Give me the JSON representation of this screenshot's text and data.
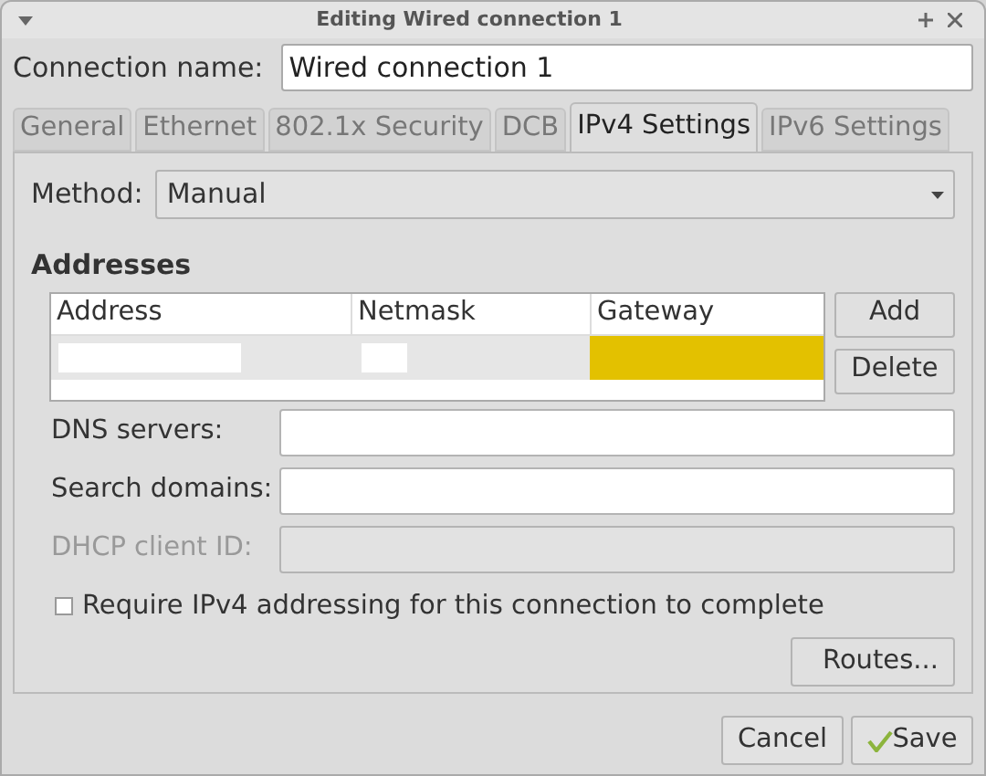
{
  "window": {
    "title": "Editing Wired connection 1"
  },
  "connection_name": {
    "label": "Connection name:",
    "value": "Wired connection 1"
  },
  "tabs": [
    {
      "label": "General",
      "selected": false
    },
    {
      "label": "Ethernet",
      "selected": false
    },
    {
      "label": "802.1x Security",
      "selected": false
    },
    {
      "label": "DCB",
      "selected": false
    },
    {
      "label": "IPv4 Settings",
      "selected": true
    },
    {
      "label": "IPv6 Settings",
      "selected": false
    }
  ],
  "method": {
    "label": "Method:",
    "value": "Manual"
  },
  "addresses": {
    "title": "Addresses",
    "columns": [
      "Address",
      "Netmask",
      "Gateway"
    ],
    "rows": [
      {
        "cells": [
          {
            "redacted": true,
            "editing": false
          },
          {
            "redacted": true,
            "editing": false
          },
          {
            "redacted": false,
            "editing": true
          }
        ]
      }
    ],
    "buttons": [
      "Add",
      "Delete"
    ]
  },
  "fields": [
    {
      "label": "DNS servers:",
      "disabled": false
    },
    {
      "label": "Search domains:",
      "disabled": false
    },
    {
      "label": "DHCP client ID:",
      "disabled": true
    }
  ],
  "require_checkbox": {
    "label": "Require IPv4 addressing for this connection to complete",
    "checked": false
  },
  "routes_button": "Routes...",
  "footer_buttons": [
    {
      "label": "Cancel",
      "kind": "plain"
    },
    {
      "label": "Save",
      "kind": "save"
    }
  ]
}
